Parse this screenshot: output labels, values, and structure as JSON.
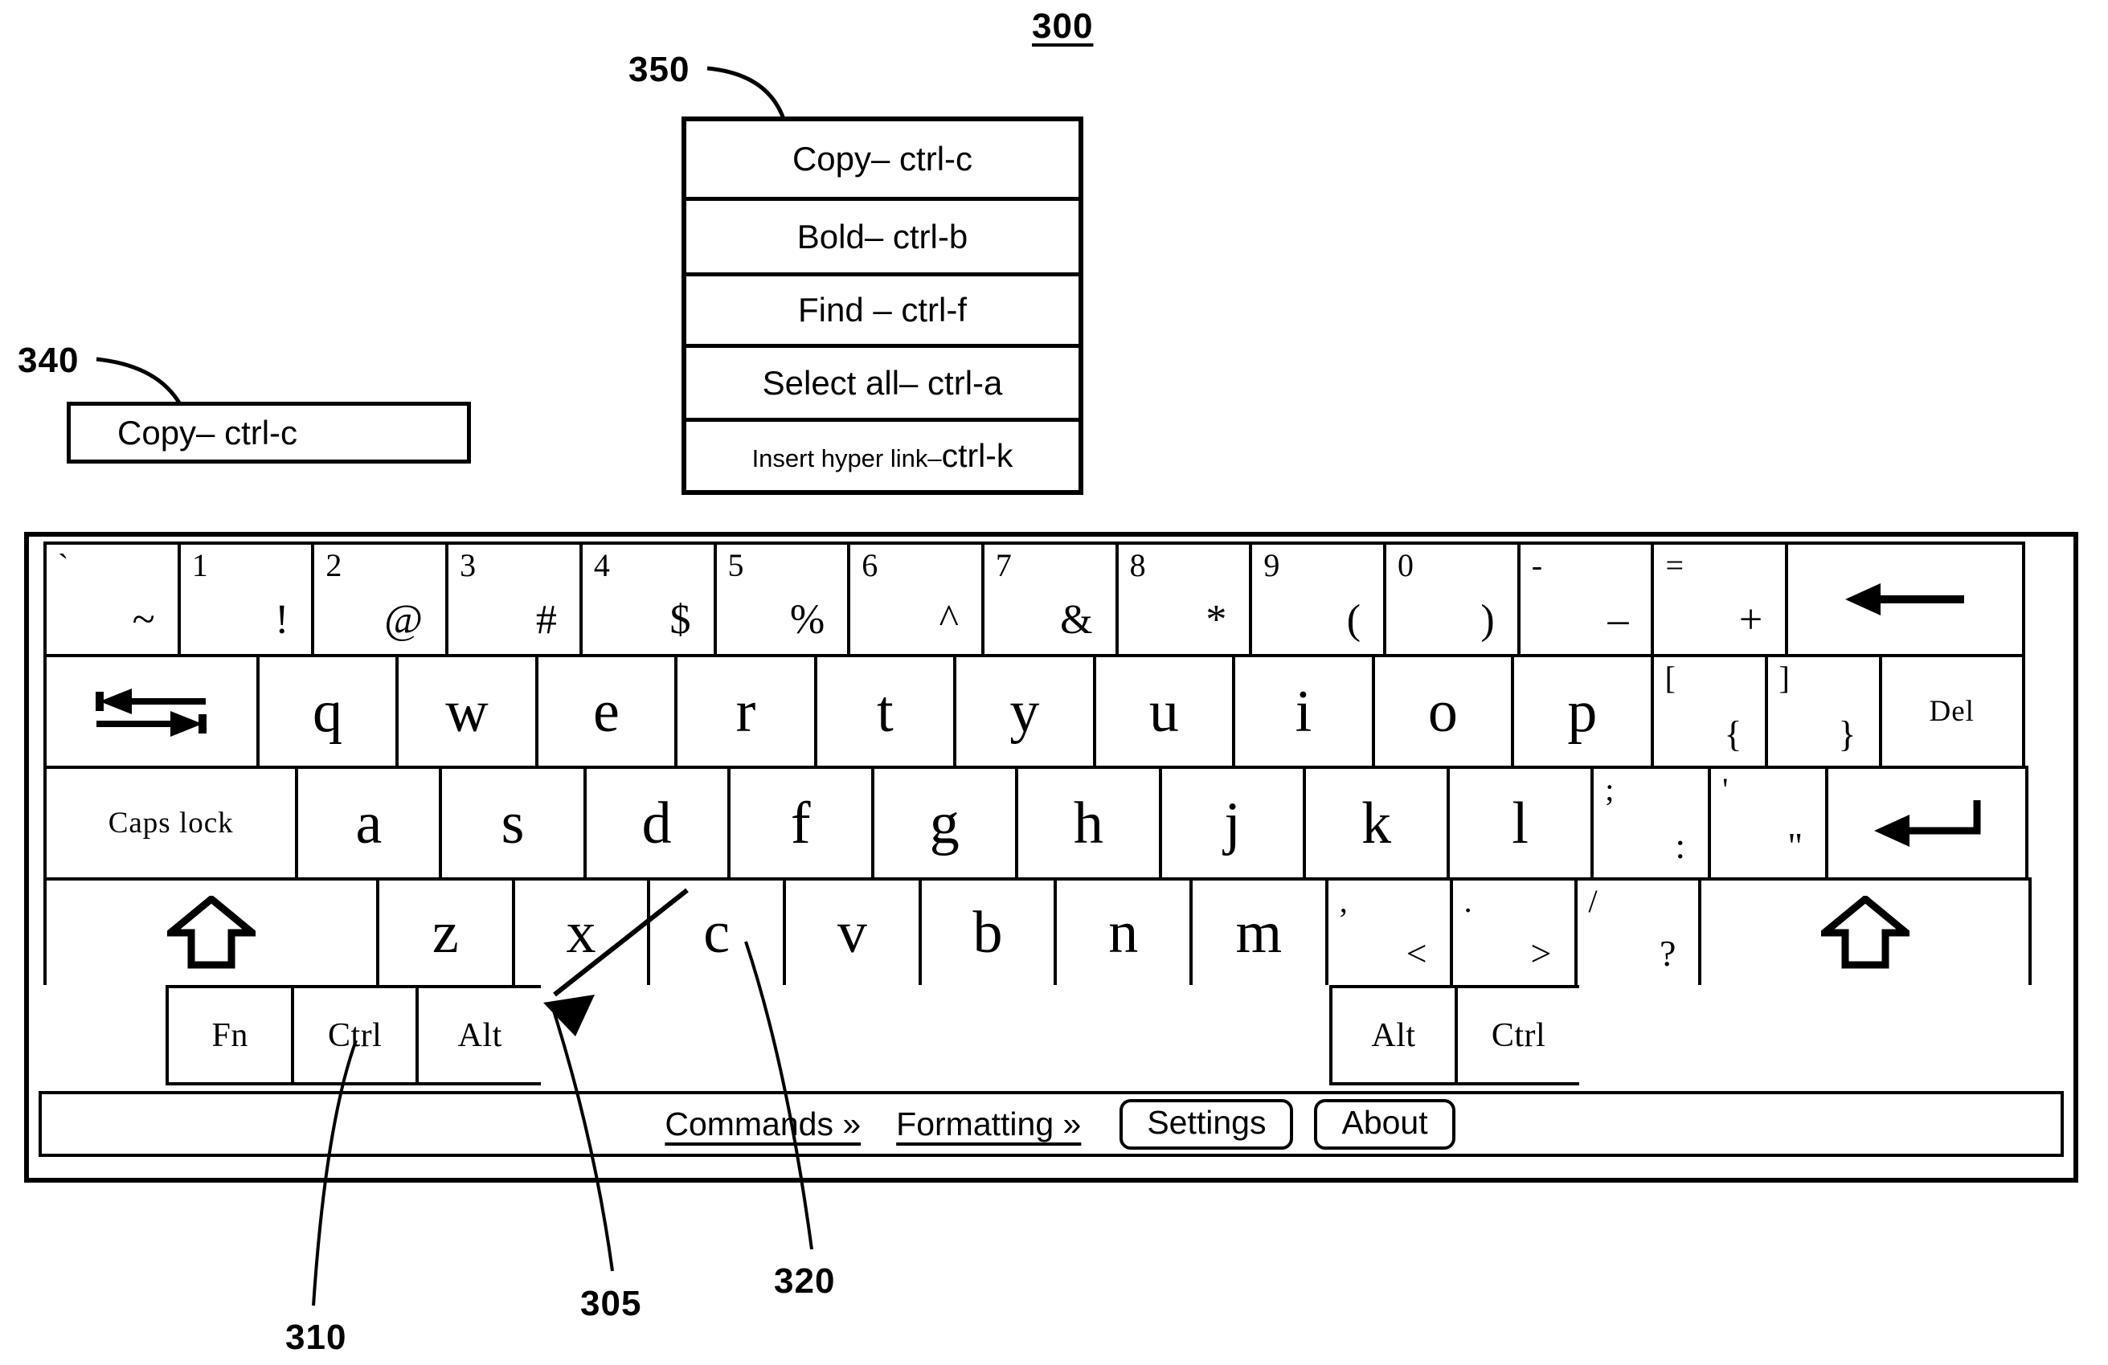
{
  "figure": {
    "main_ref": "300",
    "refs": [
      {
        "id": "340",
        "label": "340"
      },
      {
        "id": "350",
        "label": "350"
      },
      {
        "id": "310",
        "label": "310"
      },
      {
        "id": "305",
        "label": "305"
      },
      {
        "id": "320",
        "label": "320"
      }
    ]
  },
  "single_popup": {
    "ref": "340",
    "item": "Copy– ctrl-c"
  },
  "menu_popup": {
    "ref": "350",
    "items": [
      {
        "label": "Copy– ctrl-c",
        "small": false
      },
      {
        "label": "Bold– ctrl-b",
        "small": false
      },
      {
        "label": "Find – ctrl-f",
        "small": false
      },
      {
        "label": "Select all– ctrl-a",
        "small": false
      },
      {
        "label": "Insert hyper link–",
        "accel": "ctrl-k",
        "small": true
      }
    ]
  },
  "keyboard": {
    "rows": [
      {
        "name": "number-row",
        "keys": [
          {
            "name": "key-backquote",
            "top": "`",
            "bottom": "~",
            "flex": 1
          },
          {
            "name": "key-1",
            "top": "1",
            "bottom": "!",
            "flex": 1
          },
          {
            "name": "key-2",
            "top": "2",
            "bottom": "@",
            "flex": 1
          },
          {
            "name": "key-3",
            "top": "3",
            "bottom": "#",
            "flex": 1
          },
          {
            "name": "key-4",
            "top": "4",
            "bottom": "$",
            "flex": 1
          },
          {
            "name": "key-5",
            "top": "5",
            "bottom": "%",
            "flex": 1
          },
          {
            "name": "key-6",
            "top": "6",
            "bottom": "^",
            "flex": 1
          },
          {
            "name": "key-7",
            "top": "7",
            "bottom": "&",
            "flex": 1
          },
          {
            "name": "key-8",
            "top": "8",
            "bottom": "*",
            "flex": 1
          },
          {
            "name": "key-9",
            "top": "9",
            "bottom": "(",
            "flex": 1
          },
          {
            "name": "key-0",
            "top": "0",
            "bottom": ")",
            "flex": 1
          },
          {
            "name": "key-minus",
            "top": "-",
            "bottom": "–",
            "flex": 1
          },
          {
            "name": "key-equals",
            "top": "=",
            "bottom": "+",
            "flex": 1
          },
          {
            "name": "key-backspace",
            "icon": "backspace-arrow-icon",
            "flex": 1.75
          }
        ]
      },
      {
        "name": "qwerty-row",
        "keys": [
          {
            "name": "key-tab",
            "icon": "tab-arrows-icon",
            "flex": 1.62
          },
          {
            "name": "key-q",
            "letter": "q",
            "flex": 1.07
          },
          {
            "name": "key-w",
            "letter": "w",
            "flex": 1.07
          },
          {
            "name": "key-e",
            "letter": "e",
            "flex": 1.07
          },
          {
            "name": "key-r",
            "letter": "r",
            "flex": 1.07
          },
          {
            "name": "key-t",
            "letter": "t",
            "flex": 1.07
          },
          {
            "name": "key-y",
            "letter": "y",
            "flex": 1.07
          },
          {
            "name": "key-u",
            "letter": "u",
            "flex": 1.07
          },
          {
            "name": "key-i",
            "letter": "i",
            "flex": 1.07
          },
          {
            "name": "key-o",
            "letter": "o",
            "flex": 1.07
          },
          {
            "name": "key-p",
            "letter": "p",
            "flex": 1.07
          },
          {
            "name": "key-bracket-left",
            "top": "[",
            "bottom": "{",
            "flex": 0.88
          },
          {
            "name": "key-bracket-right",
            "top": "]",
            "bottom": "}",
            "flex": 0.88
          },
          {
            "name": "key-del",
            "word": "Del",
            "flex": 1.1
          }
        ]
      },
      {
        "name": "home-row",
        "keys": [
          {
            "name": "key-caps-lock",
            "word": "Caps lock",
            "flex": 1.82
          },
          {
            "name": "key-a",
            "letter": "a",
            "flex": 1.05
          },
          {
            "name": "key-s",
            "letter": "s",
            "flex": 1.05
          },
          {
            "name": "key-d",
            "letter": "d",
            "flex": 1.05
          },
          {
            "name": "key-f",
            "letter": "f",
            "flex": 1.05
          },
          {
            "name": "key-g",
            "letter": "g",
            "flex": 1.05
          },
          {
            "name": "key-h",
            "letter": "h",
            "flex": 1.05
          },
          {
            "name": "key-j",
            "letter": "j",
            "flex": 1.05
          },
          {
            "name": "key-k",
            "letter": "k",
            "flex": 1.05
          },
          {
            "name": "key-l",
            "letter": "l",
            "flex": 1.05
          },
          {
            "name": "key-semicolon",
            "top": ";",
            "bottom": ":",
            "flex": 0.86
          },
          {
            "name": "key-quote",
            "top": "'",
            "bottom": "\"",
            "flex": 0.86
          },
          {
            "name": "key-enter",
            "icon": "enter-arrow-icon",
            "flex": 1.45
          }
        ]
      },
      {
        "name": "bottom-letter-row",
        "keys": [
          {
            "name": "key-shift-left",
            "icon": "shift-up-arrow-icon",
            "flex": 2.42
          },
          {
            "name": "key-z",
            "letter": "z",
            "flex": 1.0
          },
          {
            "name": "key-x",
            "letter": "x",
            "flex": 1.0
          },
          {
            "name": "key-c",
            "letter": "c",
            "flex": 1.0
          },
          {
            "name": "key-v",
            "letter": "v",
            "flex": 1.0
          },
          {
            "name": "key-b",
            "letter": "b",
            "flex": 1.0
          },
          {
            "name": "key-n",
            "letter": "n",
            "flex": 1.0
          },
          {
            "name": "key-m",
            "letter": "m",
            "flex": 1.0
          },
          {
            "name": "key-comma",
            "top": ",",
            "bottom": "<",
            "flex": 0.92
          },
          {
            "name": "key-period",
            "top": ".",
            "bottom": ">",
            "flex": 0.92
          },
          {
            "name": "key-slash",
            "top": "/",
            "bottom": "?",
            "flex": 0.92
          },
          {
            "name": "key-shift-right",
            "icon": "shift-up-arrow-icon",
            "flex": 2.4
          }
        ]
      },
      {
        "name": "modifier-row",
        "keys": [
          {
            "name": "key-spacer-left",
            "blank": true,
            "flex": 1.0
          },
          {
            "name": "key-fn",
            "word": "Fn",
            "flex": 1.02
          },
          {
            "name": "key-ctrl-left",
            "word": "Ctrl",
            "flex": 1.02
          },
          {
            "name": "key-alt-left",
            "word": "Alt",
            "flex": 1.02
          },
          {
            "name": "key-space",
            "blank": true,
            "flex": 6.3
          },
          {
            "name": "key-alt-right",
            "word": "Alt",
            "flex": 1.02
          },
          {
            "name": "key-ctrl-right",
            "word": "Ctrl",
            "flex": 1.02
          },
          {
            "name": "key-spacer-right",
            "blank": true,
            "flex": 3.7
          }
        ]
      }
    ]
  },
  "toolbar": {
    "commands_link": "Commands »",
    "formatting_link": "Formatting »",
    "settings_button": "Settings",
    "about_button": "About"
  }
}
